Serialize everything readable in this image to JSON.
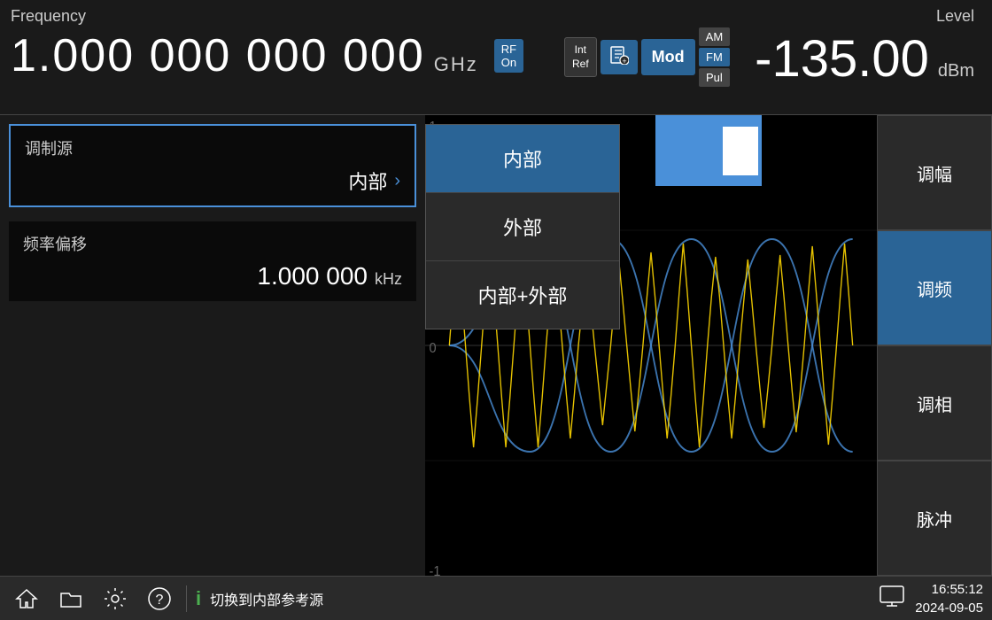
{
  "header": {
    "freq_label": "Frequency",
    "freq_value": "1.000 000 000 000",
    "freq_unit": "GHz",
    "rf_on_label": "RF\nOn",
    "int_ref_label": "Int\nRef",
    "mod_label": "Mod",
    "am_label": "AM",
    "fm_label": "FM",
    "pul_label": "Pul",
    "level_label": "Level",
    "level_value": "-135.00",
    "level_unit": "dBm"
  },
  "main": {
    "mod_source_label": "调制源",
    "mod_source_value": "内部",
    "freq_offset_label": "频率偏移",
    "freq_offset_value": "1.000 000",
    "freq_offset_unit": "kHz"
  },
  "dropdown": {
    "items": [
      {
        "label": "内部",
        "active": true
      },
      {
        "label": "外部",
        "active": false
      },
      {
        "label": "内部+外部",
        "active": false
      }
    ]
  },
  "sidebar": {
    "buttons": [
      {
        "label": "调幅",
        "active": false
      },
      {
        "label": "调频",
        "active": true
      },
      {
        "label": "调相",
        "active": false
      },
      {
        "label": "脉冲",
        "active": false
      }
    ]
  },
  "bottom": {
    "message": "切换到内部参考源",
    "time": "16:55:12",
    "date": "2024-09-05"
  },
  "waveform": {
    "y_max": "1",
    "y_zero": "0",
    "y_min": "-1"
  }
}
